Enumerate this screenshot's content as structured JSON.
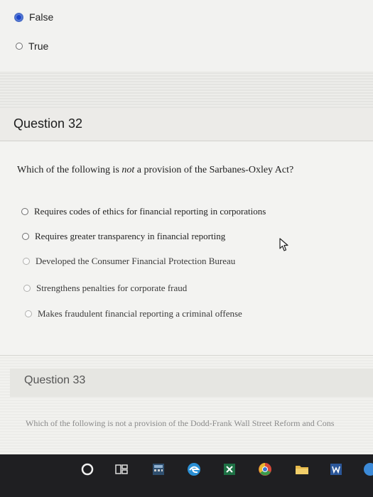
{
  "previous_question": {
    "options": [
      {
        "label": "False",
        "selected": true
      },
      {
        "label": "True",
        "selected": false
      }
    ]
  },
  "question32": {
    "title": "Question 32",
    "prompt_before": "Which of the following is ",
    "prompt_emph": "not",
    "prompt_after": " a provision of the Sarbanes-Oxley Act?",
    "options": [
      {
        "label": "Requires codes of ethics for financial reporting in corporations"
      },
      {
        "label": "Requires greater transparency in financial reporting"
      },
      {
        "label": "Developed the Consumer Financial Protection Bureau"
      },
      {
        "label": "Strengthens penalties for corporate fraud"
      },
      {
        "label": "Makes fraudulent financial reporting a criminal offense"
      }
    ]
  },
  "question33": {
    "title": "Question 33",
    "prompt": "Which of the following is not a provision of the Dodd-Frank Wall Street Reform and Cons"
  },
  "taskbar": {
    "icons": [
      "cortana-icon",
      "task-view-icon",
      "calculator-icon",
      "edge-icon",
      "excel-icon",
      "chrome-icon",
      "file-explorer-icon",
      "word-icon",
      "app-icon"
    ]
  }
}
